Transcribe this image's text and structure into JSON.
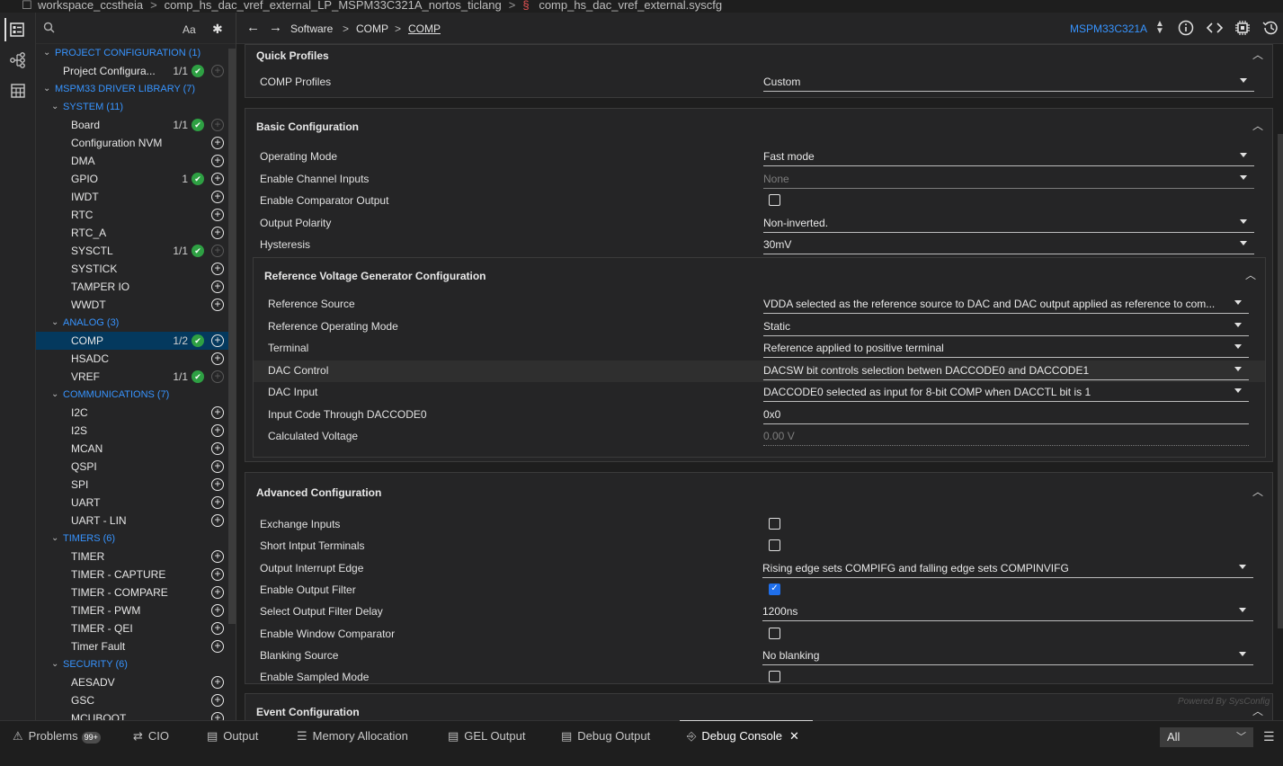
{
  "path": {
    "segments": [
      "workspace_ccstheia",
      "comp_hs_dac_vref_external_LP_MSPM33C321A_nortos_ticlang",
      "comp_hs_dac_vref_external.syscfg"
    ]
  },
  "tree": {
    "search_case": "Aa",
    "sections": [
      {
        "label": "PROJECT CONFIGURATION (1)",
        "items": [
          {
            "label": "Project Configura...",
            "count": "1/1",
            "ok": true,
            "plus": "dim"
          }
        ]
      },
      {
        "label": "MSPM33 DRIVER LIBRARY (7)"
      },
      {
        "label": "SYSTEM (11)",
        "items": [
          {
            "label": "Board",
            "count": "1/1",
            "ok": true,
            "plus": "dim"
          },
          {
            "label": "Configuration NVM"
          },
          {
            "label": "DMA"
          },
          {
            "label": "GPIO",
            "count": "1",
            "ok": true
          },
          {
            "label": "IWDT"
          },
          {
            "label": "RTC"
          },
          {
            "label": "RTC_A"
          },
          {
            "label": "SYSCTL",
            "count": "1/1",
            "ok": true,
            "plus": "dim"
          },
          {
            "label": "SYSTICK"
          },
          {
            "label": "TAMPER IO"
          },
          {
            "label": "WWDT"
          }
        ]
      },
      {
        "label": "ANALOG (3)",
        "items": [
          {
            "label": "COMP",
            "count": "1/2",
            "ok": true,
            "selected": true
          },
          {
            "label": "HSADC"
          },
          {
            "label": "VREF",
            "count": "1/1",
            "ok": true,
            "plus": "dim"
          }
        ]
      },
      {
        "label": "COMMUNICATIONS (7)",
        "items": [
          {
            "label": "I2C"
          },
          {
            "label": "I2S"
          },
          {
            "label": "MCAN"
          },
          {
            "label": "QSPI"
          },
          {
            "label": "SPI"
          },
          {
            "label": "UART"
          },
          {
            "label": "UART - LIN"
          }
        ]
      },
      {
        "label": "TIMERS (6)",
        "items": [
          {
            "label": "TIMER"
          },
          {
            "label": "TIMER - CAPTURE"
          },
          {
            "label": "TIMER - COMPARE"
          },
          {
            "label": "TIMER - PWM"
          },
          {
            "label": "TIMER - QEI"
          },
          {
            "label": "Timer Fault"
          }
        ]
      },
      {
        "label": "SECURITY (6)",
        "items": [
          {
            "label": "AESADV"
          },
          {
            "label": "GSC"
          },
          {
            "label": "MCUBOOT"
          }
        ]
      }
    ]
  },
  "nav": {
    "crumbs": [
      "Software",
      "COMP",
      "COMP"
    ],
    "separator": ">",
    "device": "MSPM33C321A"
  },
  "panels": {
    "quick": {
      "title": "Quick Profiles",
      "rows": [
        {
          "label": "COMP Profiles",
          "value": "Custom",
          "type": "select"
        }
      ]
    },
    "basic": {
      "title": "Basic Configuration",
      "rows": [
        {
          "label": "Operating Mode",
          "value": "Fast mode",
          "type": "select"
        },
        {
          "label": "Enable Channel Inputs",
          "value": "None",
          "type": "select-dim"
        },
        {
          "label": "Enable Comparator Output",
          "type": "checkbox",
          "checked": false
        },
        {
          "label": "Output Polarity",
          "value": "Non-inverted.",
          "type": "select"
        },
        {
          "label": "Hysteresis",
          "value": "30mV",
          "type": "select"
        }
      ]
    },
    "ref": {
      "title": "Reference Voltage Generator Configuration",
      "rows": [
        {
          "label": "Reference Source",
          "value": "VDDA selected as the reference source to DAC and DAC output applied as reference to com...",
          "type": "select"
        },
        {
          "label": "Reference Operating Mode",
          "value": "Static",
          "type": "select"
        },
        {
          "label": "Terminal",
          "value": "Reference applied to positive terminal",
          "type": "select"
        },
        {
          "label": "DAC Control",
          "value": "DACSW bit controls selection betwen DACCODE0 and DACCODE1",
          "type": "select",
          "highlight": true
        },
        {
          "label": "DAC Input",
          "value": "DACCODE0 selected as input for 8-bit COMP when DACCTL bit is 1",
          "type": "select"
        },
        {
          "label": "Input Code Through DACCODE0",
          "value": "0x0",
          "type": "text"
        },
        {
          "label": "Calculated Voltage",
          "value": "0.00 V",
          "type": "readonly"
        }
      ]
    },
    "advanced": {
      "title": "Advanced Configuration",
      "rows": [
        {
          "label": "Exchange Inputs",
          "type": "checkbox",
          "checked": false
        },
        {
          "label": "Short Intput Terminals",
          "type": "checkbox",
          "checked": false
        },
        {
          "label": "Output Interrupt Edge",
          "value": "Rising edge sets COMPIFG and falling edge sets COMPINVIFG",
          "type": "select"
        },
        {
          "label": "Enable Output Filter",
          "type": "checkbox",
          "checked": true
        },
        {
          "label": "Select Output Filter Delay",
          "value": "1200ns",
          "type": "select"
        },
        {
          "label": "Enable Window Comparator",
          "type": "checkbox",
          "checked": false
        },
        {
          "label": "Blanking Source",
          "value": "No blanking",
          "type": "select"
        },
        {
          "label": "Enable Sampled Mode",
          "type": "checkbox",
          "checked": false
        }
      ]
    },
    "event": {
      "title": "Event Configuration"
    },
    "powered_by": "Powered By SysConfig"
  },
  "bottom": {
    "tabs": [
      {
        "label": "Problems",
        "icon": "warning-icon",
        "badge": "99+"
      },
      {
        "label": "CIO",
        "icon": "arrows-icon"
      },
      {
        "label": "Output",
        "icon": "document-icon"
      },
      {
        "label": "Memory Allocation",
        "icon": "list-icon"
      },
      {
        "label": "GEL Output",
        "icon": "document-icon"
      },
      {
        "label": "Debug Output",
        "icon": "document-icon"
      },
      {
        "label": "Debug Console",
        "icon": "debug-icon",
        "active": true
      }
    ],
    "filter": "All"
  },
  "colors": {
    "accent": "#3794ff",
    "ok": "#2ea043",
    "selected": "#04395e"
  }
}
